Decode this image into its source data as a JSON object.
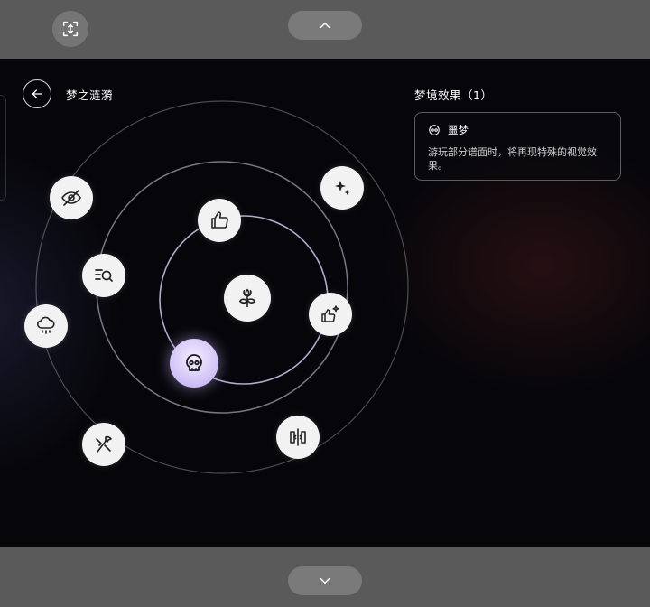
{
  "top_nav": {
    "expand_icon": "expand-vertical-icon",
    "up_icon": "chevron-up-icon"
  },
  "bottom_nav": {
    "down_icon": "chevron-down-icon"
  },
  "screen": {
    "title": "梦之涟漪",
    "panel_title": "梦境效果（1）",
    "effect": {
      "name": "噩梦",
      "description": "游玩部分谱面时，将再现特殊的视觉效果。",
      "icon": "mask-icon"
    }
  },
  "nodes": [
    {
      "icon": "flower-icon",
      "ring": "center"
    },
    {
      "icon": "skull-icon",
      "ring": "inner",
      "selected": true
    },
    {
      "icon": "thumbs-up-icon",
      "ring": "inner"
    },
    {
      "icon": "thumbs-up-sparkle-icon",
      "ring": "inner"
    },
    {
      "icon": "search-list-icon",
      "ring": "middle"
    },
    {
      "icon": "sparkles-icon",
      "ring": "middle"
    },
    {
      "icon": "split-columns-icon",
      "ring": "middle"
    },
    {
      "icon": "eye-off-icon",
      "ring": "outer"
    },
    {
      "icon": "rain-cloud-icon",
      "ring": "outer"
    },
    {
      "icon": "tools-icon",
      "ring": "outer"
    }
  ],
  "colors": {
    "accent": "#cbbcf5",
    "bar": "#5a5a5a",
    "node": "#f2f2f2"
  }
}
